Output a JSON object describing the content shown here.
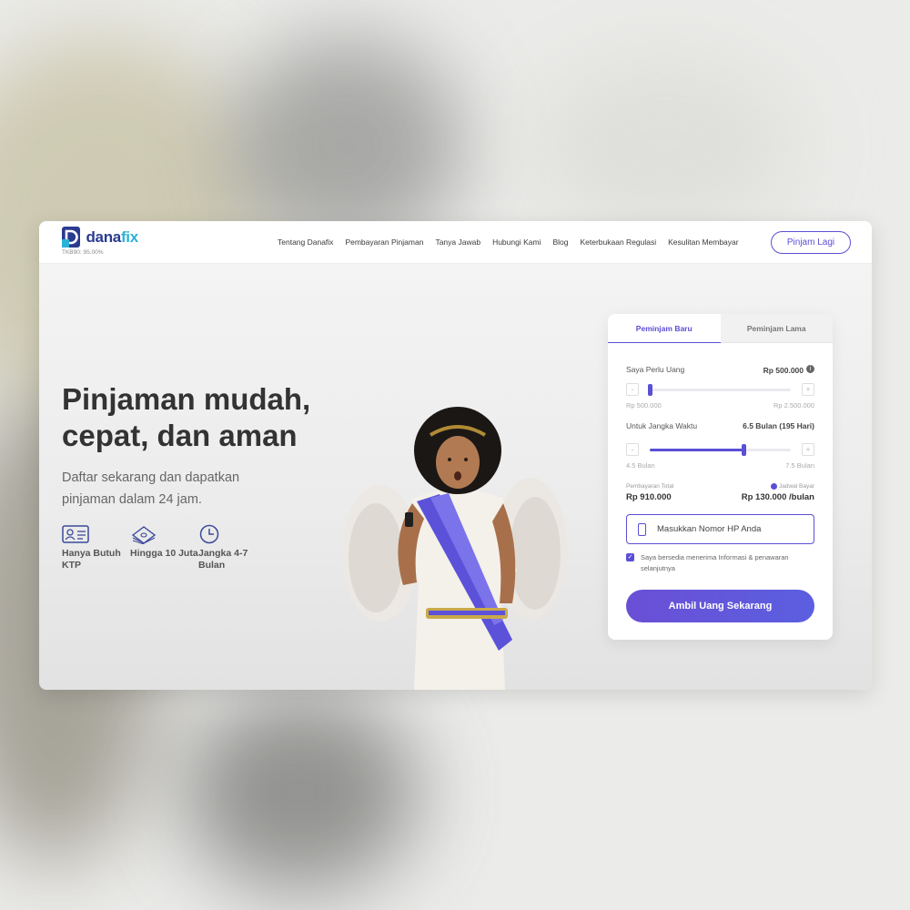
{
  "brand": {
    "name_part1": "dana",
    "name_part2": "fix",
    "tkb": "TKB90: 95.00%",
    "logo_colors": {
      "primary": "#2a3b8f",
      "secondary": "#2ab3d6"
    }
  },
  "nav": {
    "items": [
      {
        "label": "Tentang Danafix"
      },
      {
        "label": "Pembayaran Pinjaman"
      },
      {
        "label": "Tanya Jawab"
      },
      {
        "label": "Hubungi Kami"
      },
      {
        "label": "Blog"
      },
      {
        "label": "Keterbukaan Regulasi"
      },
      {
        "label": "Kesulitan Membayar"
      }
    ],
    "cta_label": "Pinjam Lagi"
  },
  "hero": {
    "title": "Pinjaman mudah, cepat, dan aman",
    "subtitle": "Daftar sekarang dan dapatkan pinjaman dalam 24 jam.",
    "features": [
      {
        "icon": "id-card-icon",
        "label": "Hanya Butuh KTP"
      },
      {
        "icon": "money-stack-icon",
        "label": "Hingga 10 Juta"
      },
      {
        "icon": "clock-icon",
        "label": "Jangka 4-7 Bulan"
      }
    ]
  },
  "calculator": {
    "tabs": [
      {
        "label": "Peminjam Baru",
        "active": true
      },
      {
        "label": "Peminjam Lama",
        "active": false
      }
    ],
    "amount": {
      "label": "Saya Perlu Uang",
      "value": "Rp 500.000",
      "min_label": "Rp 500.000",
      "max_label": "Rp 2.500.000",
      "fraction": 0.0
    },
    "term": {
      "label": "Untuk Jangka Waktu",
      "value": "6.5 Bulan (195 Hari)",
      "min_label": "4.5 Bulan",
      "max_label": "7.5 Bulan",
      "fraction": 0.667
    },
    "stepper": {
      "minus": "-",
      "plus": "+"
    },
    "total": {
      "label": "Pembayaran Total",
      "value": "Rp 910.000"
    },
    "schedule": {
      "label": "Jadwal Bayar",
      "value": "Rp 130.000 /bulan"
    },
    "phone": {
      "placeholder": "Masukkan Nomor HP Anda"
    },
    "consent": {
      "checked": true,
      "text": "Saya bersedia menerima Informasi & penawaran selanjutnya"
    },
    "submit_label": "Ambil Uang Sekarang"
  },
  "colors": {
    "accent": "#5b4fd6",
    "title_text": "#333333",
    "body_text": "#666666"
  }
}
